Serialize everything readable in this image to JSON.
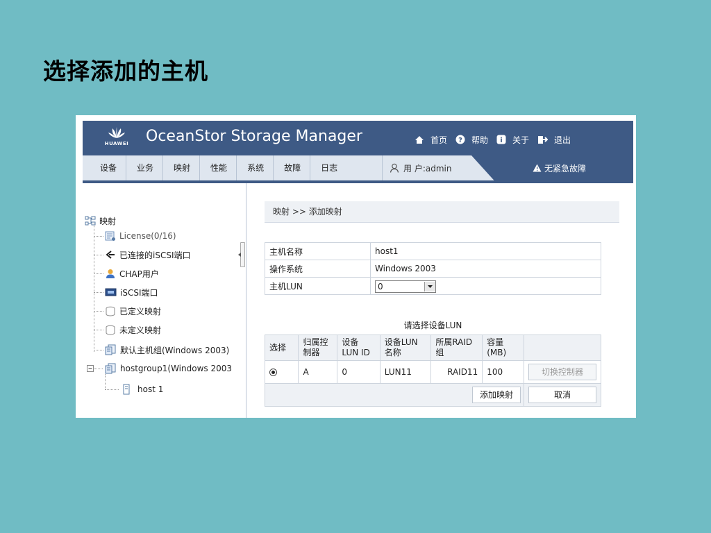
{
  "slide": {
    "title": "选择添加的主机"
  },
  "app": {
    "brand": "HUAWEI",
    "title": "OceanStor Storage Manager",
    "top_links": [
      {
        "label": "首页",
        "icon": "home-icon"
      },
      {
        "label": "帮助",
        "icon": "help-icon"
      },
      {
        "label": "关于",
        "icon": "info-icon"
      },
      {
        "label": "退出",
        "icon": "exit-icon"
      }
    ],
    "menu": [
      "设备",
      "业务",
      "映射",
      "性能",
      "系统",
      "故障",
      "日志"
    ],
    "user_label": "用 户:admin",
    "alert_text": "无紧急故障"
  },
  "tree": {
    "root": "映射",
    "items": [
      {
        "label": "License(0/16)",
        "icon": "license-icon"
      },
      {
        "label": "已连接的iSCSI端口",
        "icon": "connected-port-icon"
      },
      {
        "label": "CHAP用户",
        "icon": "chap-user-icon"
      },
      {
        "label": "iSCSI端口",
        "icon": "iscsi-port-icon"
      },
      {
        "label": "已定义映射",
        "icon": "defined-mapping-icon"
      },
      {
        "label": "未定义映射",
        "icon": "undefined-mapping-icon"
      },
      {
        "label": "默认主机组(Windows 2003)",
        "icon": "host-group-icon"
      },
      {
        "label": "hostgroup1(Windows 2003",
        "icon": "host-group-icon"
      }
    ],
    "child": {
      "label": "host 1",
      "icon": "host-icon"
    }
  },
  "content": {
    "breadcrumb": "映射 >> 添加映射",
    "host_info": [
      {
        "label": "主机名称",
        "value": "host1"
      },
      {
        "label": "操作系统",
        "value": "Windows 2003"
      },
      {
        "label": "主机LUN",
        "value": "0"
      }
    ],
    "lun_caption": "请选择设备LUN",
    "lun_headers": [
      "选择",
      "归属控制器",
      "设备 LUN ID",
      "设备LUN 名称",
      "所属RAID 组",
      "容量 (MB)"
    ],
    "lun_headers_lines": [
      [
        "选择"
      ],
      [
        "归属控",
        "制器"
      ],
      [
        "设备",
        "LUN ID"
      ],
      [
        "设备LUN",
        "名称"
      ],
      [
        "所属RAID",
        "组"
      ],
      [
        "容量",
        "(MB)"
      ]
    ],
    "lun_rows": [
      {
        "selected": true,
        "controller": "A",
        "lun_id": "0",
        "lun_name": "LUN11",
        "raid_group": "RAID11",
        "capacity": "100"
      }
    ],
    "switch_button": "切换控制器",
    "add_button": "添加映射",
    "cancel_button": "取消"
  }
}
